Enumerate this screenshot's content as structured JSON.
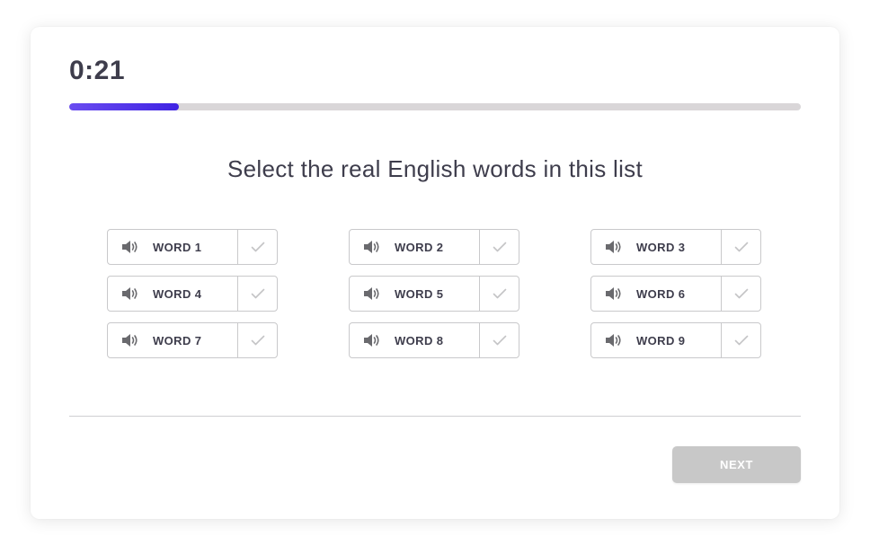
{
  "timer": "0:21",
  "progress": {
    "fraction": 0.15,
    "color_start": "#6a4cf0",
    "color_end": "#3f23e3"
  },
  "instruction": "Select the real English words in this list",
  "words": [
    {
      "label": "WORD 1"
    },
    {
      "label": "WORD 2"
    },
    {
      "label": "WORD 3"
    },
    {
      "label": "WORD 4"
    },
    {
      "label": "WORD 5"
    },
    {
      "label": "WORD 6"
    },
    {
      "label": "WORD 7"
    },
    {
      "label": "WORD 8"
    },
    {
      "label": "WORD 9"
    }
  ],
  "icons": {
    "audio": "speaker-icon",
    "check": "checkmark-icon"
  },
  "next_button": {
    "label": "NEXT",
    "enabled": false,
    "color": "#c8c8c8"
  }
}
